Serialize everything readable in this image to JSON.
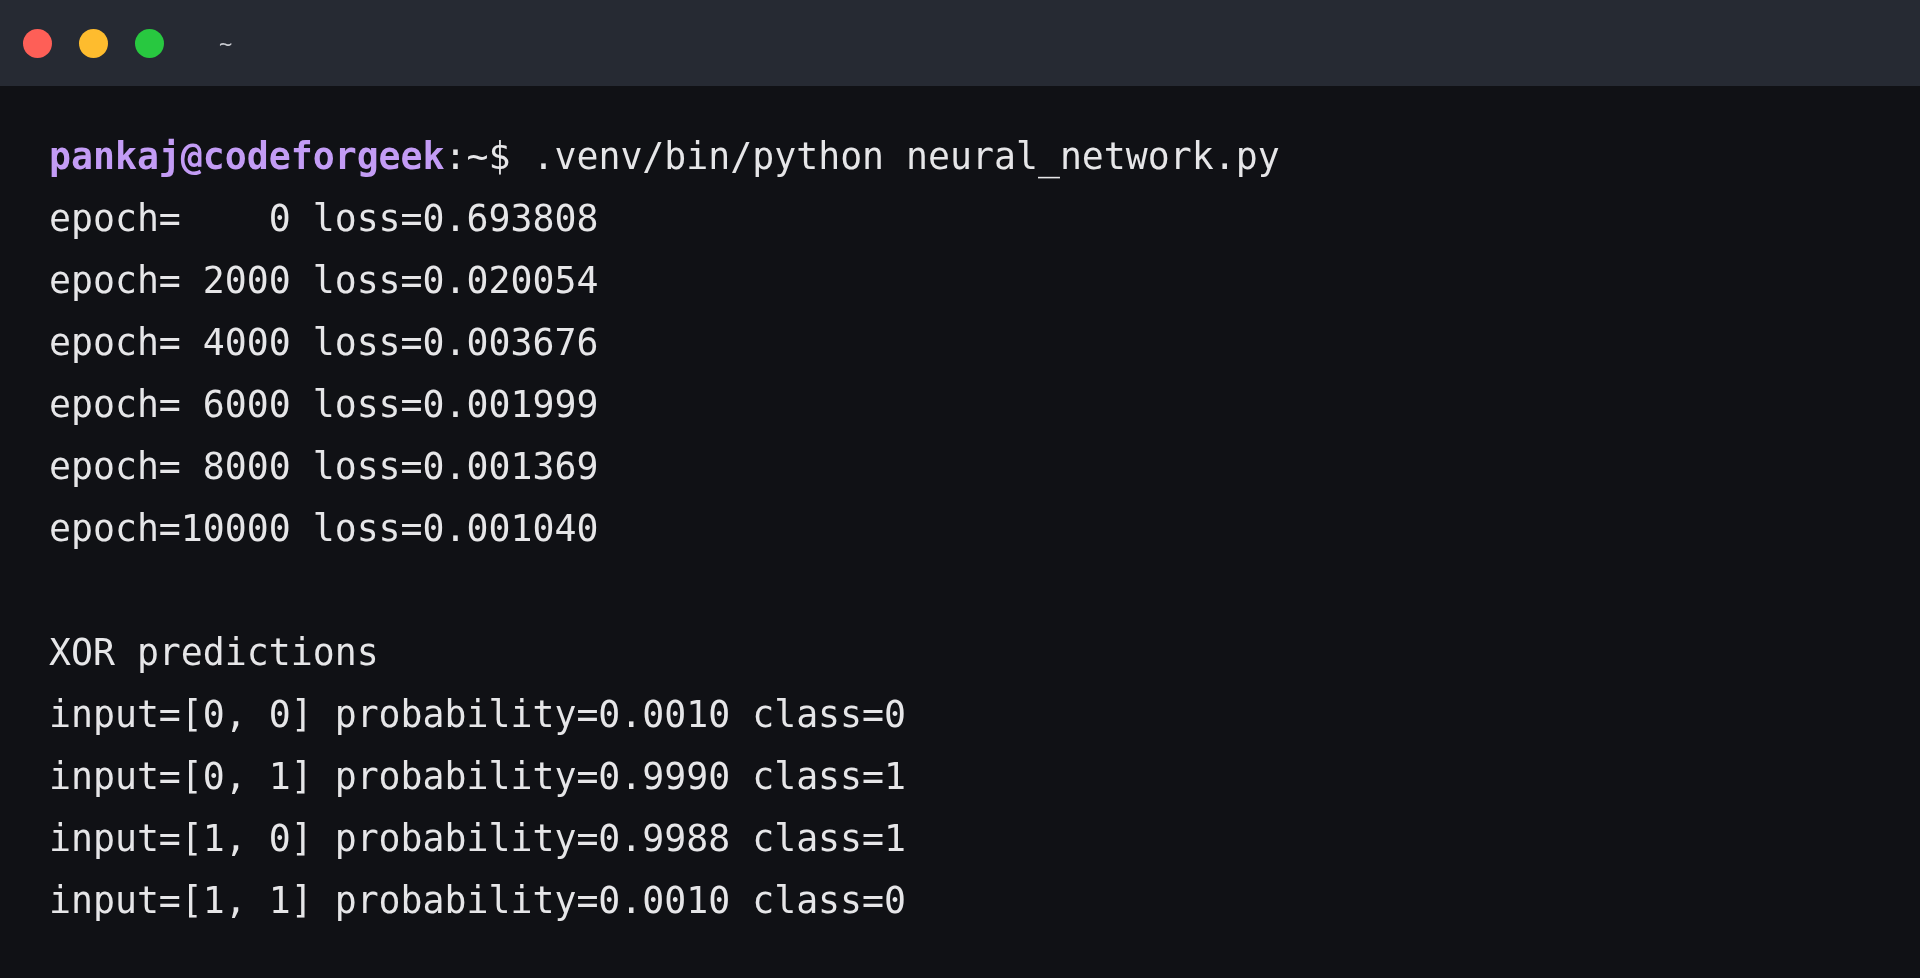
{
  "window": {
    "title": "~"
  },
  "prompt": {
    "user": "pankaj@codeforgeek",
    "path": ":~$",
    "command": ".venv/bin/python neural_network.py"
  },
  "training_log": [
    "epoch=    0 loss=0.693808",
    "epoch= 2000 loss=0.020054",
    "epoch= 4000 loss=0.003676",
    "epoch= 6000 loss=0.001999",
    "epoch= 8000 loss=0.001369",
    "epoch=10000 loss=0.001040"
  ],
  "predictions": {
    "heading": "XOR predictions",
    "lines": [
      "input=[0, 0] probability=0.0010 class=0",
      "input=[0, 1] probability=0.9990 class=1",
      "input=[1, 0] probability=0.9988 class=1",
      "input=[1, 1] probability=0.0010 class=0"
    ]
  }
}
